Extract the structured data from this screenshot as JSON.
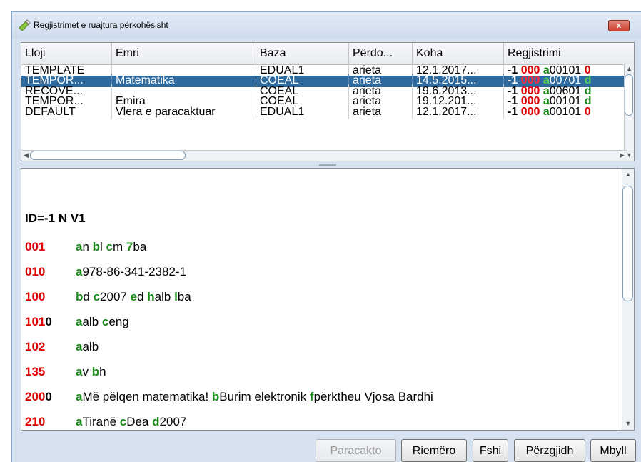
{
  "window": {
    "title": "Regjistrimet e ruajtura përkohësisht",
    "icon": "pencil-eraser-icon",
    "close_label": "x"
  },
  "table": {
    "columns": [
      "Lloji",
      "Emri",
      "Baza",
      "Përdo...",
      "Koha",
      "Regjistrimi"
    ],
    "rows": [
      {
        "type": "TEMPLATE",
        "name": "",
        "base": "EDUAL1",
        "user": "arieta",
        "time": "12.1.2017...",
        "reg_prefix": "-1",
        "reg_tag": "000",
        "reg_code": "a",
        "reg_value": "00101",
        "reg_tail": "0",
        "reg_tail_color": "red",
        "selected": false
      },
      {
        "type": "TEMPOR...",
        "name": "Matematika",
        "base": "COEAL",
        "user": "arieta",
        "time": "14.5.2015...",
        "reg_prefix": "-1",
        "reg_tag": "000",
        "reg_code": "a",
        "reg_value": "00701",
        "reg_tail": "d",
        "reg_tail_color": "green",
        "selected": true
      },
      {
        "type": "RECOVE...",
        "name": "",
        "base": "COEAL",
        "user": "arieta",
        "time": "19.6.2013...",
        "reg_prefix": "-1",
        "reg_tag": "000",
        "reg_code": "a",
        "reg_value": "00601",
        "reg_tail": "d",
        "reg_tail_color": "green",
        "selected": false
      },
      {
        "type": "TEMPOR...",
        "name": "Emira",
        "base": "COEAL",
        "user": "arieta",
        "time": "19.12.201...",
        "reg_prefix": "-1",
        "reg_tag": "000",
        "reg_code": "a",
        "reg_value": "00101",
        "reg_tail": "d",
        "reg_tail_color": "green",
        "selected": false
      },
      {
        "type": "DEFAULT",
        "name": "Vlera e paracaktuar",
        "base": "EDUAL1",
        "user": "arieta",
        "time": "12.1.2017...",
        "reg_prefix": "-1",
        "reg_tag": "000",
        "reg_code": "a",
        "reg_value": "00101",
        "reg_tail": "0",
        "reg_tail_color": "red",
        "selected": false
      }
    ]
  },
  "record": {
    "header": "ID=-1 N V1",
    "lines": [
      {
        "tag": "001",
        "ind": "",
        "subfields": [
          {
            "code": "a",
            "value": "n "
          },
          {
            "code": "b",
            "value": "l "
          },
          {
            "code": "c",
            "value": "m "
          },
          {
            "code": "7",
            "value": "ba"
          }
        ]
      },
      {
        "tag": "010",
        "ind": "",
        "subfields": [
          {
            "code": "a",
            "value": "978-86-341-2382-1"
          }
        ]
      },
      {
        "tag": "100",
        "ind": "",
        "subfields": [
          {
            "code": "b",
            "value": "d "
          },
          {
            "code": "c",
            "value": "2007 "
          },
          {
            "code": "e",
            "value": "d "
          },
          {
            "code": "h",
            "value": "alb "
          },
          {
            "code": "l",
            "value": "ba"
          }
        ]
      },
      {
        "tag": "101",
        "ind": "0",
        "subfields": [
          {
            "code": "a",
            "value": "alb "
          },
          {
            "code": "c",
            "value": "eng"
          }
        ]
      },
      {
        "tag": "102",
        "ind": "",
        "subfields": [
          {
            "code": "a",
            "value": "alb"
          }
        ]
      },
      {
        "tag": "135",
        "ind": "",
        "subfields": [
          {
            "code": "a",
            "value": "v "
          },
          {
            "code": "b",
            "value": "h"
          }
        ]
      },
      {
        "tag": "200",
        "ind": "0",
        "subfields": [
          {
            "code": "a",
            "value": "Më pëlqen matematika! "
          },
          {
            "code": "b",
            "value": "Burim elektronik "
          },
          {
            "code": "f",
            "value": "përktheu Vjosa Bardhi"
          }
        ]
      },
      {
        "tag": "210",
        "ind": "",
        "subfields": [
          {
            "code": "a",
            "value": "Tiranë "
          },
          {
            "code": "c",
            "value": "Dea "
          },
          {
            "code": "d",
            "value": "2007"
          }
        ]
      }
    ]
  },
  "buttons": [
    {
      "label": "Paracakto",
      "enabled": false
    },
    {
      "label": "Riemëro",
      "enabled": true
    },
    {
      "label": "Fshi",
      "enabled": true
    },
    {
      "label": "Përzgjidh",
      "enabled": true
    },
    {
      "label": "Mbyll",
      "enabled": true
    }
  ]
}
